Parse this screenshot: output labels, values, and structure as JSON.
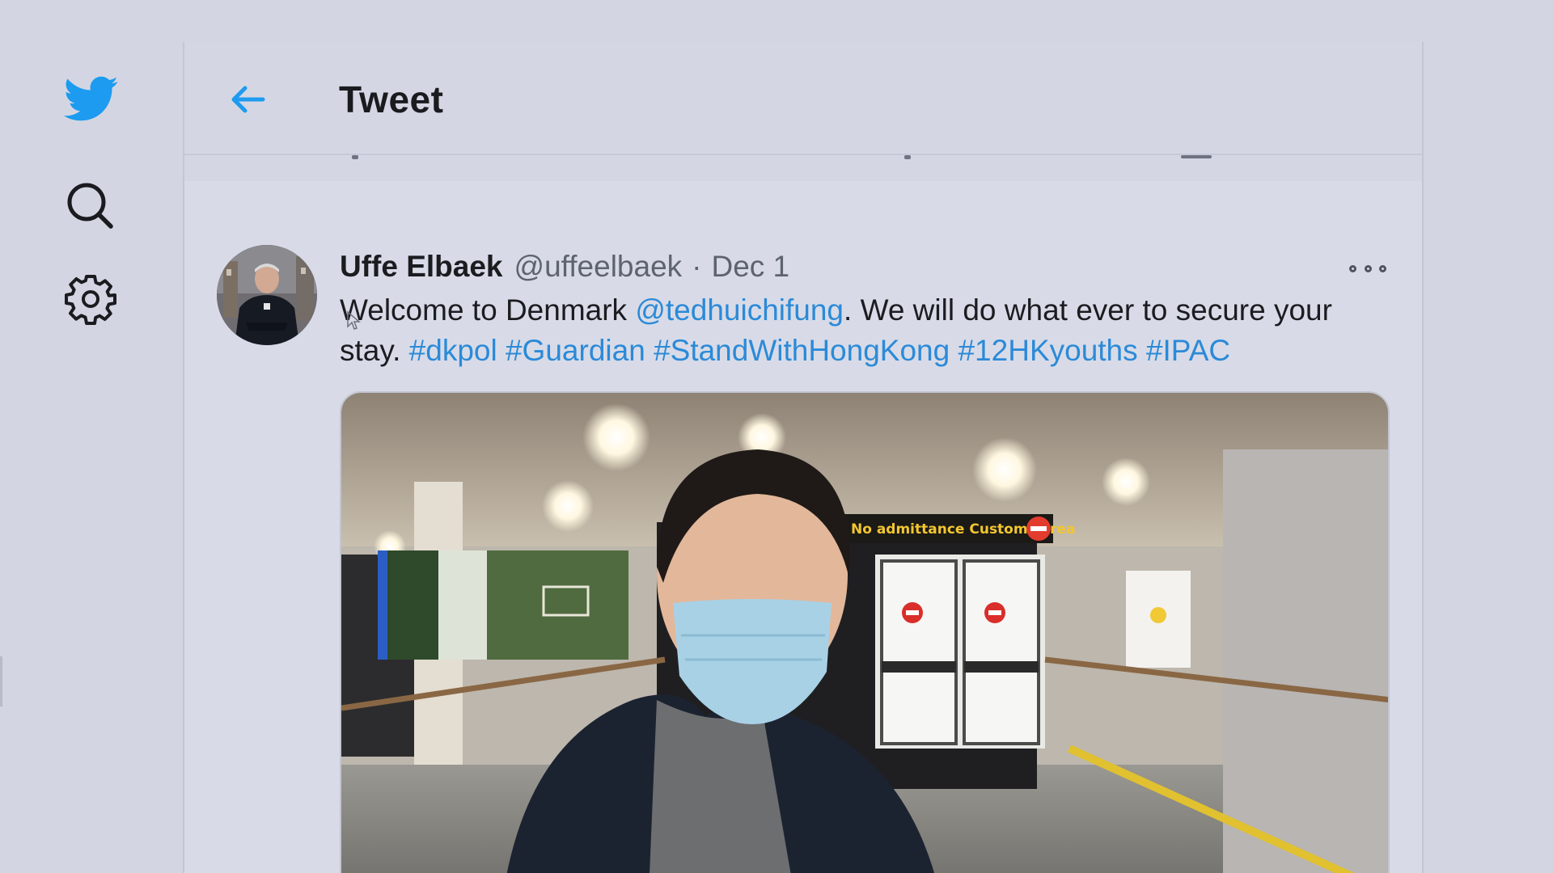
{
  "nav": {
    "icons": [
      "twitter-bird-icon",
      "search-icon",
      "gear-icon"
    ],
    "accent_color": "#1d9bf0"
  },
  "header": {
    "title": "Tweet",
    "back_icon": "arrow-left-icon"
  },
  "tweet": {
    "author_name": "Uffe Elbaek",
    "handle": "@uffeelbaek",
    "separator": "·",
    "date": "Dec 1",
    "text_parts": [
      {
        "text": "Welcome to Denmark ",
        "link": false
      },
      {
        "text": "@tedhuichifung",
        "link": true
      },
      {
        "text": ". We will do what ever to secure your stay. ",
        "link": false
      },
      {
        "text": "#dkpol",
        "link": true
      },
      {
        "text": " ",
        "link": false
      },
      {
        "text": "#Guardian",
        "link": true
      },
      {
        "text": " ",
        "link": false
      },
      {
        "text": "#StandWithHongKong",
        "link": true
      },
      {
        "text": " ",
        "link": false
      },
      {
        "text": "#12HKyouths",
        "link": true
      },
      {
        "text": " ",
        "link": false
      },
      {
        "text": "#IPAC",
        "link": true
      }
    ],
    "link_color": "#2b8ad8",
    "more_icon": "more-options-icon",
    "media": {
      "description_icon": "photo-image",
      "signs": [
        "No admittance Customs area"
      ]
    }
  }
}
